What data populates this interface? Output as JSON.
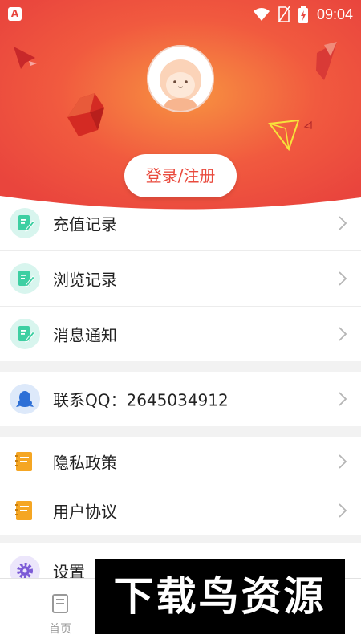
{
  "status": {
    "app_badge": "A",
    "time": "09:04"
  },
  "header": {
    "login_label": "登录/注册"
  },
  "menu": {
    "recharge": "充值记录",
    "history": "浏览记录",
    "messages": "消息通知",
    "contact_qq": "联系QQ：2645034912",
    "privacy": "隐私政策",
    "agreement": "用户协议",
    "settings": "设置"
  },
  "tabbar": {
    "home": "首页"
  },
  "watermark": "下载鸟资源",
  "colors": {
    "accent": "#e9473f",
    "header_center": "#f68a40",
    "icon_bg": "#d8f5ee",
    "icon_green": "#3dcfa2",
    "icon_blue": "#2d6fd6",
    "icon_orange": "#f5a623",
    "icon_purple": "#7b5ad6"
  }
}
